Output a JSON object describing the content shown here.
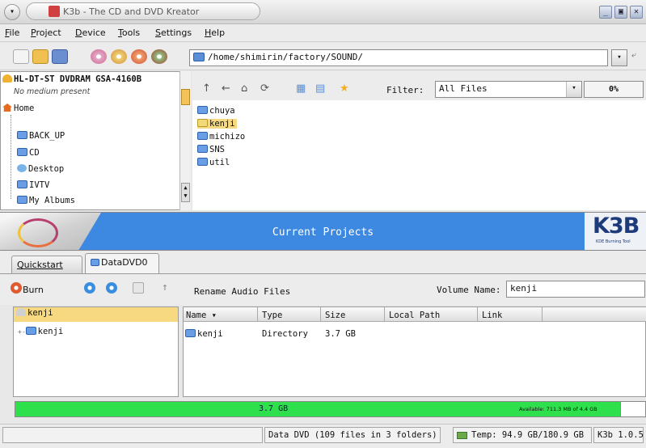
{
  "window": {
    "title": "K3b - The CD and DVD Kreator",
    "buttons": {
      "menu": "▾",
      "minimize": "_",
      "maximize": "▣",
      "close": "✕"
    }
  },
  "menubar": {
    "items": [
      "File",
      "Project",
      "Device",
      "Tools",
      "Settings",
      "Help"
    ]
  },
  "toolbar": {
    "path": "/home/shimirin/factory/SOUND/",
    "dropdown_arrow": "▾",
    "icons": [
      "new-project-icon",
      "open-project-icon",
      "save-icon",
      "copy-cd-icon",
      "burn-image-icon",
      "erase-icon",
      "settings-icon"
    ]
  },
  "tree": {
    "device": "HL-DT-ST DVDRAM GSA-4160B",
    "device_status": "No medium present",
    "home": "Home",
    "items": [
      "BACK_UP",
      "CD",
      "Desktop",
      "IVTV",
      "My Albums"
    ]
  },
  "browser": {
    "filter_label": "Filter:",
    "filter_value": "All Files",
    "percent": "0%",
    "files": [
      "chuya",
      "kenji",
      "michizo",
      "SNS",
      "util"
    ],
    "selected": "kenji"
  },
  "banner": {
    "title": "Current Projects",
    "logo": "K3B",
    "logo_sub": "KDE Burning Tool"
  },
  "tabs": [
    "Quickstart",
    "DataDVD0"
  ],
  "project_toolbar": {
    "burn": "Burn",
    "rename": "Rename Audio Files",
    "volume_label": "Volume Name:",
    "volume_value": "kenji"
  },
  "project_tree": {
    "root": "kenji",
    "child": "kenji"
  },
  "project_list": {
    "headers": [
      "Name",
      "Type",
      "Size",
      "Local Path",
      "Link"
    ],
    "rows": [
      {
        "name": "kenji",
        "type": "Directory",
        "size": "3.7 GB",
        "local_path": "",
        "link": ""
      }
    ]
  },
  "size_bar": {
    "used": "3.7 GB",
    "available": "Available: 711.3 MB of 4.4 GB",
    "fill_fraction": 0.96
  },
  "statusbar": {
    "summary": "Data DVD (109 files in 3 folders)",
    "temp": "Temp: 94.9 GB/180.9 GB",
    "version": "K3b 1.0.5"
  },
  "colors": {
    "banner": "#3d88e0",
    "size_bar": "#2ee04c",
    "selection": "#f6d980"
  }
}
